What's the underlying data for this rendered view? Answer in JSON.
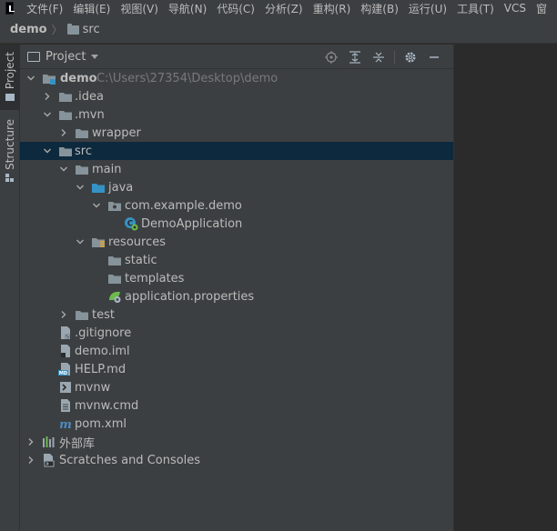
{
  "menubar": {
    "items": [
      "文件(F)",
      "编辑(E)",
      "视图(V)",
      "导航(N)",
      "代码(C)",
      "分析(Z)",
      "重构(R)",
      "构建(B)",
      "运行(U)",
      "工具(T)",
      "VCS",
      "窗"
    ]
  },
  "breadcrumb": {
    "project": "demo",
    "folder": "src",
    "separator": "〉"
  },
  "sidebar": {
    "project_tab": "Project",
    "structure_tab": "Structure"
  },
  "panel": {
    "title": "Project"
  },
  "tree": {
    "demo": {
      "label": "demo",
      "path": "C:\\Users\\27354\\Desktop\\demo"
    },
    "idea": "idea",
    "mvn": ".mvn",
    "wrapper": "wrapper",
    "src": "src",
    "main": "main",
    "java": "java",
    "package": "com.example.demo",
    "demo_app": "DemoApplication",
    "resources": "resources",
    "static": "static",
    "templates": "templates",
    "app_props": "application.properties",
    "test": "test",
    "gitignore": ".gitignore",
    "demo_iml": "demo.iml",
    "help_md": "HELP.md",
    "mvnw": "mvnw",
    "mvnw_cmd": "mvnw.cmd",
    "pom": "pom.xml",
    "ext_libs": "外部库",
    "scratches": "Scratches and Consoles"
  },
  "colors": {
    "selection": "#0d293e",
    "folder": "#87939a",
    "source_folder": "#3592c4",
    "resource_marker": "#e0a63e",
    "spring_green": "#6cb94d"
  }
}
